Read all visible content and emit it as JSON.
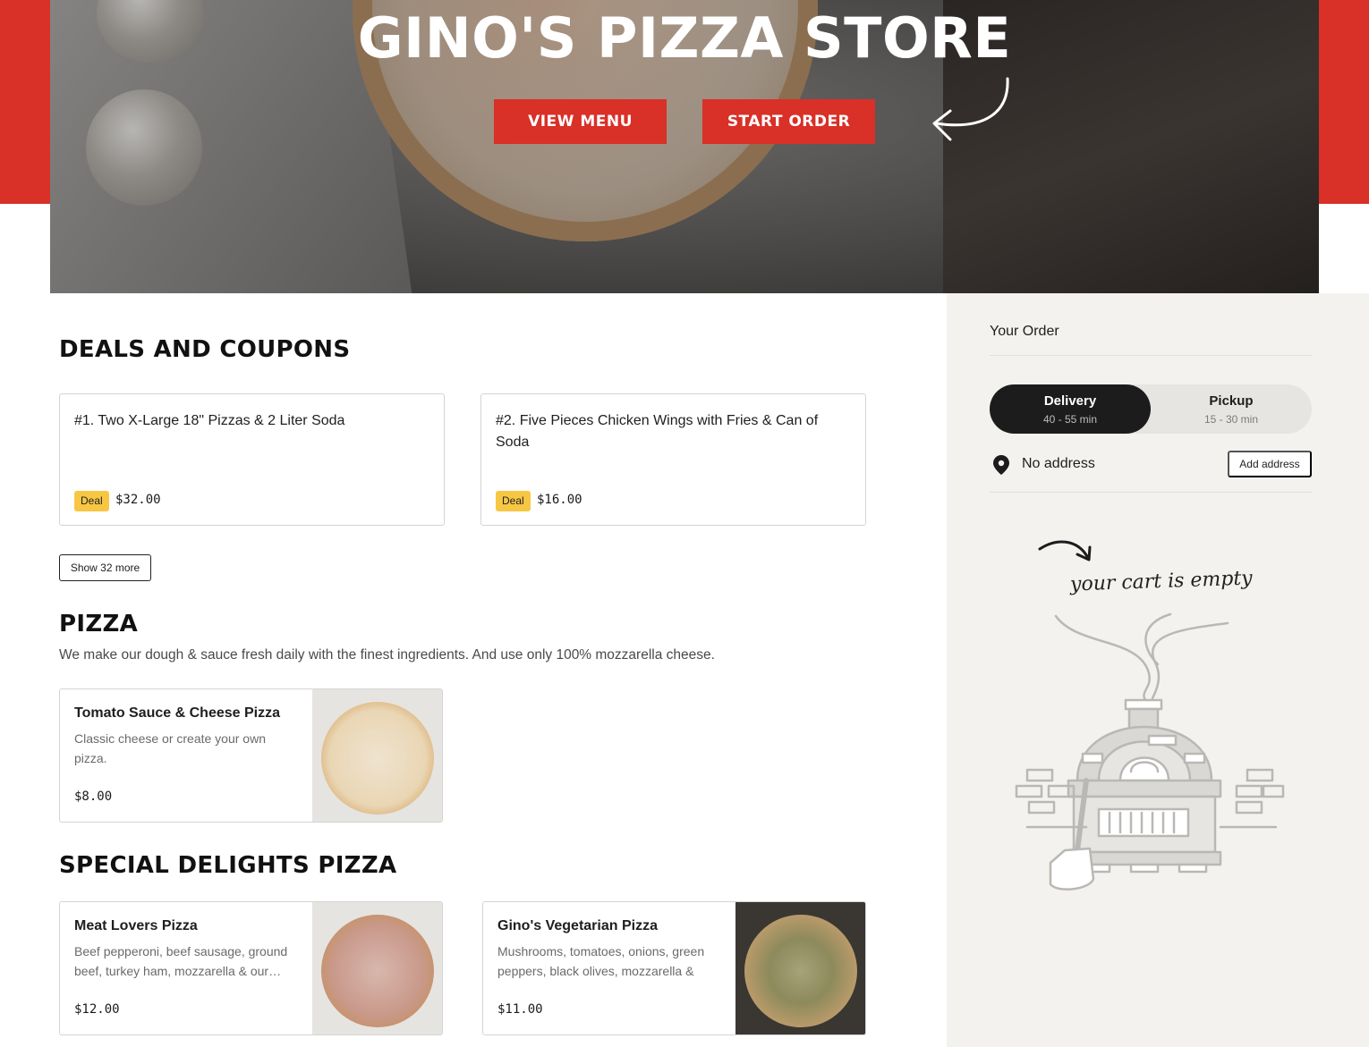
{
  "hero": {
    "title": "GINO'S PIZZA STORE",
    "view_menu_label": "VIEW MENU",
    "start_order_label": "START ORDER"
  },
  "deals": {
    "heading": "DEALS AND COUPONS",
    "items": [
      {
        "name": "#1. Two X-Large 18\" Pizzas & 2 Liter Soda",
        "badge": "Deal",
        "price": "$32.00"
      },
      {
        "name": "#2. Five Pieces Chicken Wings with Fries & Can of Soda",
        "badge": "Deal",
        "price": "$16.00"
      }
    ],
    "show_more_label": "Show 32 more"
  },
  "pizza": {
    "heading": "PIZZA",
    "description": "We make our dough & sauce fresh daily with the finest ingredients. And use only 100% mozzarella cheese.",
    "items": [
      {
        "name": "Tomato Sauce & Cheese Pizza",
        "description": "Classic cheese or create your own pizza.",
        "price": "$8.00"
      }
    ]
  },
  "special": {
    "heading": "SPECIAL DELIGHTS PIZZA",
    "items": [
      {
        "name": "Meat Lovers Pizza",
        "description": "Beef pepperoni, beef sausage, ground beef, turkey ham, mozzarella & our…",
        "price": "$12.00"
      },
      {
        "name": "Gino's Vegetarian Pizza",
        "description": "Mushrooms, tomatoes, onions, green peppers, black olives, mozzarella & ou…",
        "price": "$11.00"
      }
    ]
  },
  "order": {
    "title": "Your Order",
    "delivery_label": "Delivery",
    "delivery_time": "40 - 55 min",
    "pickup_label": "Pickup",
    "pickup_time": "15 - 30 min",
    "address_text": "No address",
    "add_address_label": "Add address",
    "empty_cart_text": "your cart is empty"
  },
  "colors": {
    "brand_red": "#d93027",
    "deal_yellow": "#f7c744",
    "sidebar_bg": "#f3f2ef"
  },
  "icons": [
    "hand-drawn-arrow-icon",
    "location-pin-icon",
    "oven-illustration"
  ]
}
